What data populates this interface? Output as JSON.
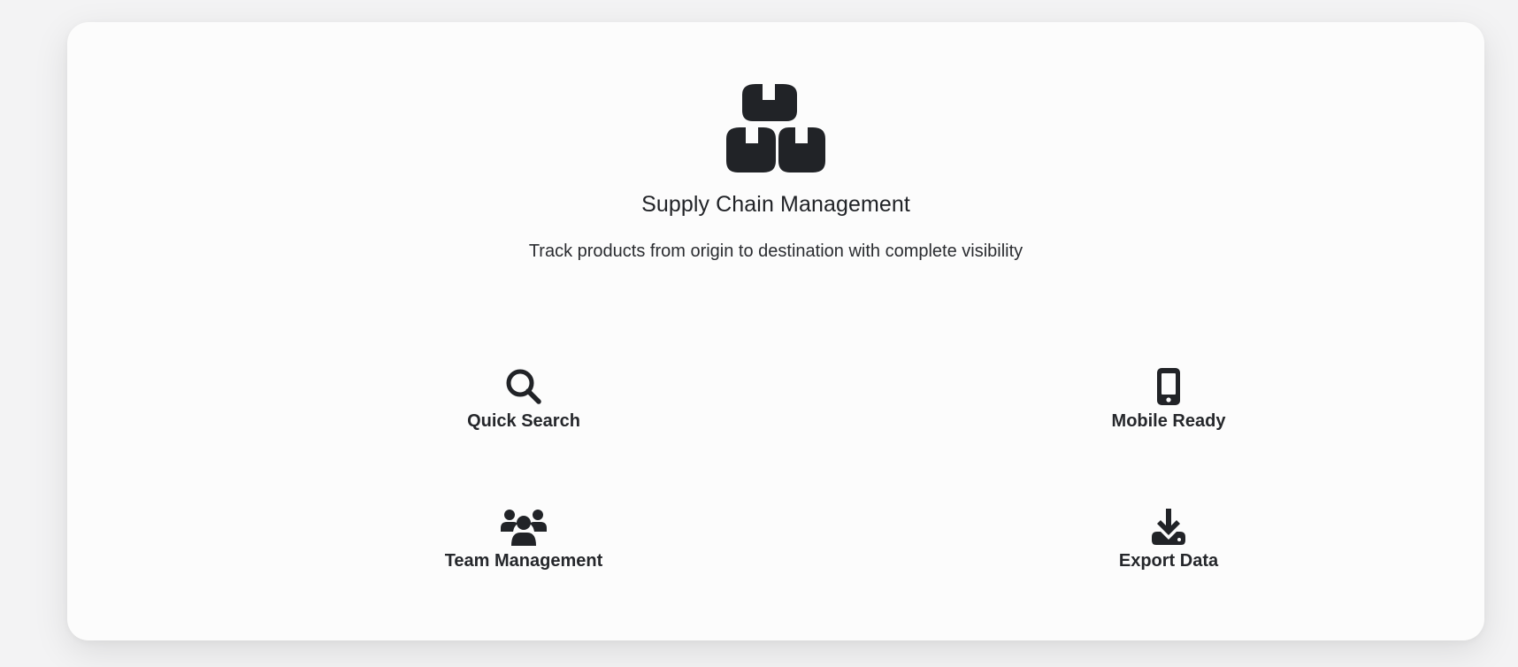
{
  "header": {
    "icon": "boxes-icon",
    "title": "Supply Chain Management",
    "subtitle": "Track products from origin to destination with complete visibility"
  },
  "features": [
    {
      "icon": "search-icon",
      "label": "Quick Search"
    },
    {
      "icon": "mobile-phone-icon",
      "label": "Mobile Ready"
    },
    {
      "icon": "users-icon",
      "label": "Team Management"
    },
    {
      "icon": "download-icon",
      "label": "Export Data"
    }
  ],
  "colors": {
    "icon": "#212327",
    "card": "#fcfcfc",
    "background": "#f3f3f4"
  }
}
